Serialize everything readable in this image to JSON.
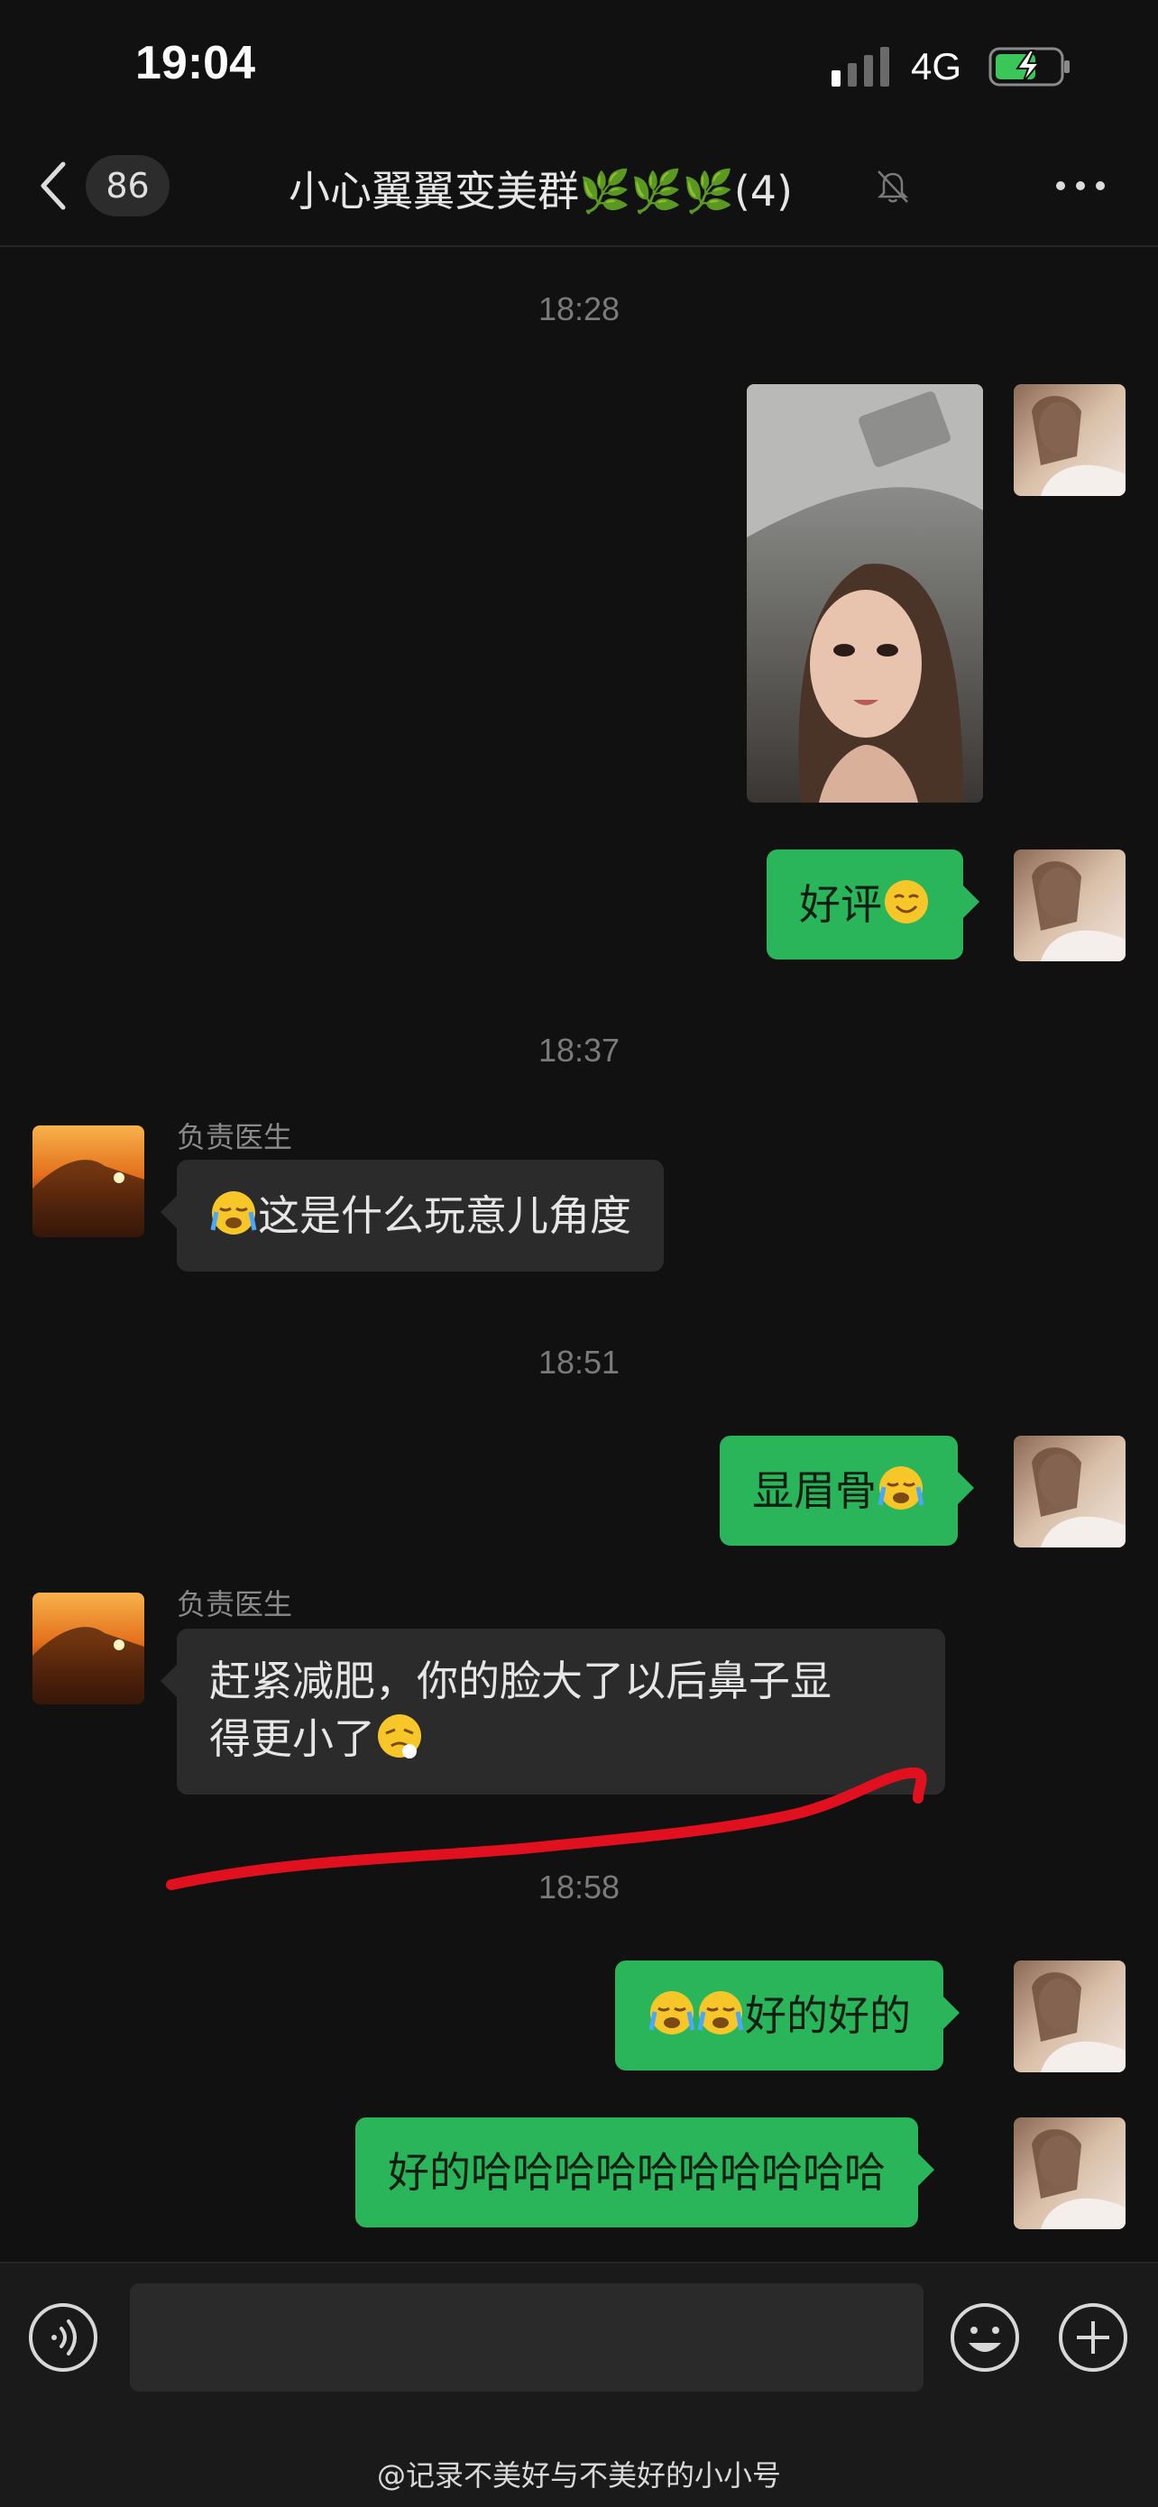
{
  "status_bar": {
    "time": "19:04",
    "network": "4G"
  },
  "nav": {
    "back_count": "86",
    "title": "小心翼翼变美群🌿🌿🌿(4)"
  },
  "timestamps": [
    "18:28",
    "18:37",
    "18:51",
    "18:58"
  ],
  "messages": [
    {
      "side": "right",
      "type": "image",
      "description": "selfie photo"
    },
    {
      "side": "right",
      "type": "text",
      "text": "好评",
      "emoji": "smile"
    },
    {
      "side": "left",
      "type": "text",
      "sender": "负责医生",
      "emoji_before": "sob",
      "text": "这是什么玩意儿角度"
    },
    {
      "side": "right",
      "type": "text",
      "text": "显眉骨",
      "emoji": "sob"
    },
    {
      "side": "left",
      "type": "text",
      "sender": "负责医生",
      "text_line1": "赶紧减肥，你的脸大了以后鼻子显",
      "text_line2": "得更小了",
      "emoji": "tired"
    },
    {
      "side": "right",
      "type": "text",
      "emoji_before": "sob-sob",
      "text": "好的好的"
    },
    {
      "side": "right",
      "type": "text",
      "text": "好的哈哈哈哈哈哈哈哈哈哈"
    }
  ],
  "watermark": "@记录不美好与不美好的小小号",
  "colors": {
    "bubble_green": "#2ab55a",
    "bubble_gray": "#2b2b2b",
    "annotation_red": "#e0101e",
    "background": "#111111"
  }
}
